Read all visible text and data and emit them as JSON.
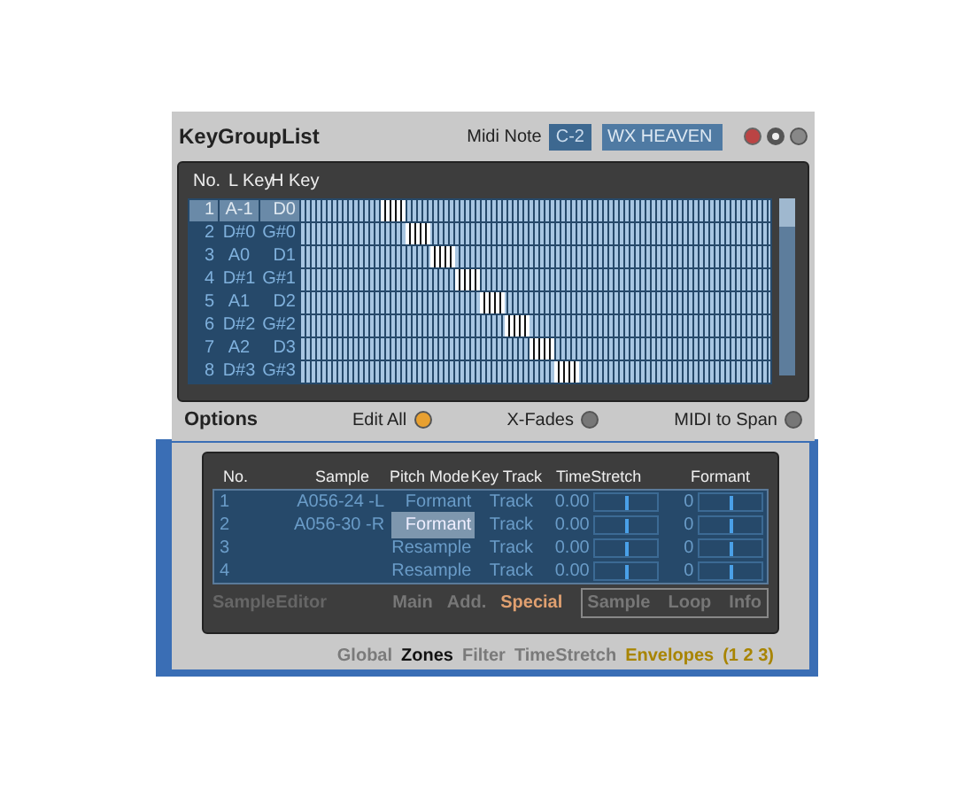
{
  "window": {
    "title": "KeyGroupList",
    "midi_note_label": "Midi Note",
    "midi_note": "C-2",
    "program_name": "WX HEAVEN"
  },
  "keygroups": {
    "columns": [
      "No.",
      "L Key",
      "H Key"
    ],
    "rows": [
      {
        "no": "1",
        "low": "A-1",
        "high": "D0",
        "selected": true
      },
      {
        "no": "2",
        "low": "D#0",
        "high": "G#0",
        "selected": false
      },
      {
        "no": "3",
        "low": "A0",
        "high": "D1",
        "selected": false
      },
      {
        "no": "4",
        "low": "D#1",
        "high": "G#1",
        "selected": false
      },
      {
        "no": "5",
        "low": "A1",
        "high": "D2",
        "selected": false
      },
      {
        "no": "6",
        "low": "D#2",
        "high": "G#2",
        "selected": false
      },
      {
        "no": "7",
        "low": "A2",
        "high": "D3",
        "selected": false
      },
      {
        "no": "8",
        "low": "D#3",
        "high": "G#3",
        "selected": false
      }
    ]
  },
  "options": {
    "label": "Options",
    "toggles": [
      {
        "label": "Edit All",
        "on": true
      },
      {
        "label": "X-Fades",
        "on": false
      },
      {
        "label": "MIDI to Span",
        "on": false
      }
    ]
  },
  "zones": {
    "columns": [
      "No.",
      "Sample",
      "Pitch Mode",
      "Key Track",
      "TimeStretch",
      "Formant"
    ],
    "rows": [
      {
        "no": "1",
        "sample": "A056-24 -L",
        "pitch_mode": "Formant",
        "selected": false,
        "key_track": "Track",
        "timestretch": {
          "value": "0.00",
          "level": 0.5
        },
        "formant": {
          "value": "0",
          "level": 0.52
        }
      },
      {
        "no": "2",
        "sample": "A056-30 -R",
        "pitch_mode": "Formant",
        "selected": true,
        "key_track": "Track",
        "timestretch": {
          "value": "0.00",
          "level": 0.5
        },
        "formant": {
          "value": "0",
          "level": 0.52
        }
      },
      {
        "no": "3",
        "sample": "",
        "pitch_mode": "Resample",
        "selected": false,
        "key_track": "Track",
        "timestretch": {
          "value": "0.00",
          "level": 0.5
        },
        "formant": {
          "value": "0",
          "level": 0.52
        }
      },
      {
        "no": "4",
        "sample": "",
        "pitch_mode": "Resample",
        "selected": false,
        "key_track": "Track",
        "timestretch": {
          "value": "0.00",
          "level": 0.5
        },
        "formant": {
          "value": "0",
          "level": 0.52
        }
      }
    ]
  },
  "editor": {
    "label": "SampleEditor",
    "tabs": [
      {
        "label": "Main",
        "selected": false
      },
      {
        "label": "Add.",
        "selected": false
      },
      {
        "label": "Special",
        "selected": true
      }
    ],
    "subtabs": [
      {
        "label": "Sample"
      },
      {
        "label": "Loop"
      },
      {
        "label": "Info"
      }
    ]
  },
  "bottom_tabs": [
    {
      "label": "Global",
      "selected": false,
      "highlighted": false
    },
    {
      "label": "Zones",
      "selected": true,
      "highlighted": false
    },
    {
      "label": "Filter",
      "selected": false,
      "highlighted": false
    },
    {
      "label": "TimeStretch",
      "selected": false,
      "highlighted": false
    },
    {
      "label": "Envelopes",
      "selected": false,
      "highlighted": true
    },
    {
      "label": "(1 2 3)",
      "selected": false,
      "highlighted": true
    }
  ]
}
